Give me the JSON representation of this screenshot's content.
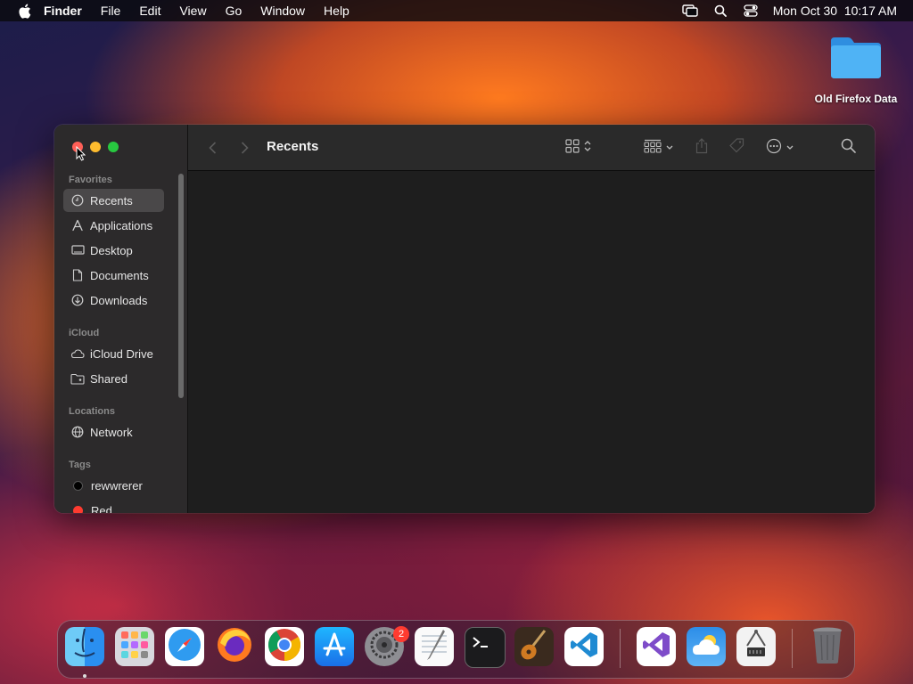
{
  "menubar": {
    "app_name": "Finder",
    "menus": [
      "File",
      "Edit",
      "View",
      "Go",
      "Window",
      "Help"
    ],
    "datetime": "Mon Oct 30  10:17 AM"
  },
  "desktop": {
    "folder_label": "Old Firefox Data"
  },
  "finder": {
    "title": "Recents",
    "sidebar": {
      "favorites_heading": "Favorites",
      "favorites": [
        {
          "label": "Recents",
          "icon": "clock-icon"
        },
        {
          "label": "Applications",
          "icon": "applications-icon"
        },
        {
          "label": "Desktop",
          "icon": "desktop-icon"
        },
        {
          "label": "Documents",
          "icon": "document-icon"
        },
        {
          "label": "Downloads",
          "icon": "download-icon"
        }
      ],
      "icloud_heading": "iCloud",
      "icloud": [
        {
          "label": "iCloud Drive",
          "icon": "cloud-icon"
        },
        {
          "label": "Shared",
          "icon": "shared-folder-icon"
        }
      ],
      "locations_heading": "Locations",
      "locations": [
        {
          "label": "Network",
          "icon": "globe-icon"
        }
      ],
      "tags_heading": "Tags",
      "tags": [
        {
          "label": "rewwrerer",
          "color": "#000000"
        },
        {
          "label": "Red",
          "color": "#ff3b30"
        }
      ]
    }
  },
  "dock": {
    "apps": [
      "Finder",
      "Launchpad",
      "Safari",
      "Firefox",
      "Chrome",
      "App Store",
      "System Settings",
      "TextEdit",
      "Terminal",
      "GarageBand",
      "Visual Studio Code",
      "Visual Studio",
      "Weather",
      "System Information",
      "Trash"
    ],
    "settings_badge": "2"
  },
  "colors": {
    "accent_close": "#ff5f57",
    "accent_minimize": "#febc2e",
    "accent_maximize": "#28c840",
    "sidebar_bg": "#2c2a2b",
    "content_bg": "#1e1e1e"
  }
}
